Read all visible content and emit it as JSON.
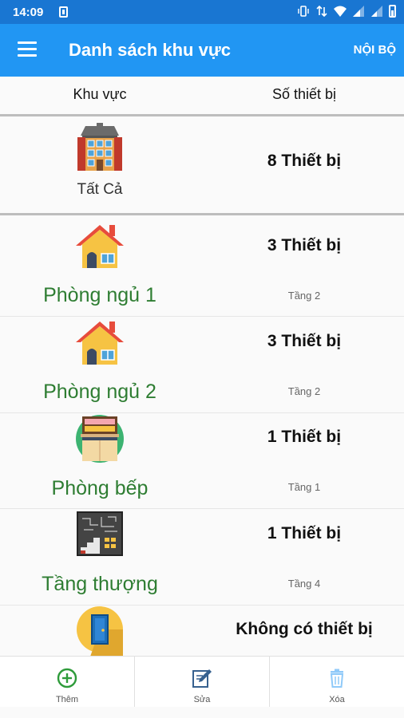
{
  "status_bar": {
    "time": "14:09"
  },
  "app_bar": {
    "title": "Danh sách khu vực",
    "action_label": "NỘI BỘ"
  },
  "columns": {
    "area": "Khu vực",
    "device_count": "Số thiết bị"
  },
  "rows": [
    {
      "name": "Tất Cả",
      "count": "8 Thiết bị",
      "floor": "",
      "icon": "building-icon"
    },
    {
      "name": "Phòng ngủ 1",
      "count": "3 Thiết bị",
      "floor": "Tầng 2",
      "icon": "house-icon"
    },
    {
      "name": "Phòng ngủ 2",
      "count": "3 Thiết bị",
      "floor": "Tầng 2",
      "icon": "house-icon"
    },
    {
      "name": "Phòng bếp",
      "count": "1 Thiết bị",
      "floor": "Tầng 1",
      "icon": "kitchen-icon"
    },
    {
      "name": "Tầng thượng",
      "count": "1 Thiết bị",
      "floor": "Tầng 4",
      "icon": "rooftop-stairs-icon"
    },
    {
      "name": "",
      "count": "Không có thiết bị",
      "floor": "",
      "icon": "door-icon"
    }
  ],
  "bottom_bar": {
    "add_label": "Thêm",
    "edit_label": "Sửa",
    "delete_label": "Xóa"
  },
  "colors": {
    "app_bar": "#2196f3",
    "status_bar": "#1976d2",
    "area_name": "#2e7d32",
    "add_icon": "#2e9b3a",
    "delete_icon": "#90caf9"
  }
}
